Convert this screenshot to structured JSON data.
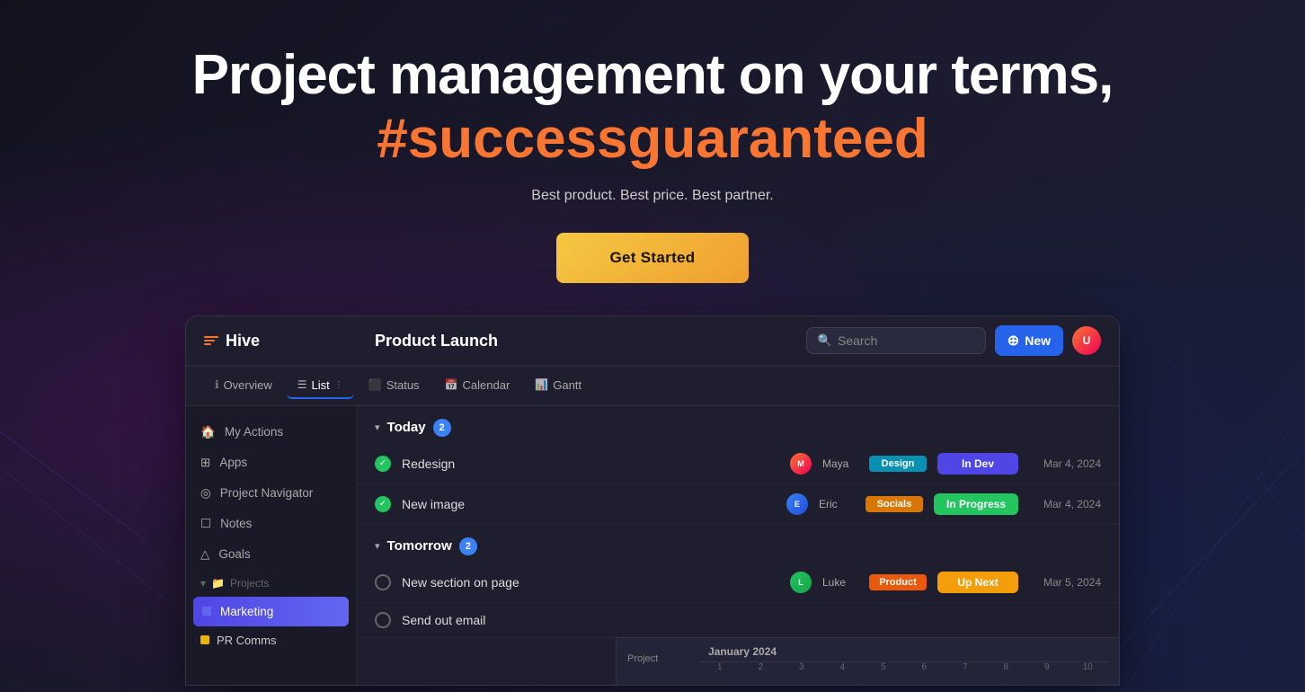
{
  "hero": {
    "title_line1": "Project management on your terms,",
    "title_line2": "#successguaranteed",
    "subtitle": "Best product. Best price. Best partner.",
    "cta": "Get Started"
  },
  "app": {
    "project_title": "Product Launch",
    "search_placeholder": "Search",
    "new_button": "New",
    "tabs": [
      {
        "label": "Overview",
        "icon": "ℹ",
        "active": false
      },
      {
        "label": "List",
        "icon": "☰",
        "active": true
      },
      {
        "label": "Status",
        "icon": "⬛",
        "active": false
      },
      {
        "label": "Calendar",
        "icon": "📅",
        "active": false
      },
      {
        "label": "Gantt",
        "icon": "📊",
        "active": false
      }
    ],
    "sidebar": {
      "logo": "Hive",
      "items": [
        {
          "label": "My Actions",
          "icon": "🏠"
        },
        {
          "label": "Apps",
          "icon": "⊞"
        },
        {
          "label": "Project Navigator",
          "icon": "◎"
        },
        {
          "label": "Notes",
          "icon": "☐"
        },
        {
          "label": "Goals",
          "icon": "△"
        }
      ],
      "section_label": "Projects",
      "projects": [
        {
          "label": "Marketing",
          "color": "#6366f1",
          "active": true
        },
        {
          "label": "PR Comms",
          "color": "#eab308"
        }
      ]
    },
    "sections": [
      {
        "title": "Today",
        "count": 2,
        "tasks": [
          {
            "name": "Redesign",
            "assignee": "Maya",
            "tag": "Design",
            "tag_class": "tag-design",
            "status": "In Dev",
            "status_class": "status-indev",
            "due": "Mar 4, 2024",
            "done": true
          },
          {
            "name": "New image",
            "assignee": "Eric",
            "tag": "Socials",
            "tag_class": "tag-socials",
            "status": "In Progress",
            "status_class": "status-inprogress",
            "due": "Mar 4, 2024",
            "done": true
          }
        ]
      },
      {
        "title": "Tomorrow",
        "count": 2,
        "tasks": [
          {
            "name": "New section on page",
            "assignee": "Luke",
            "tag": "Product",
            "tag_class": "tag-product",
            "status": "Up Next",
            "status_class": "status-upnext",
            "due": "Mar 5, 2024",
            "done": false
          },
          {
            "name": "Send out email",
            "assignee": "",
            "tag": "",
            "tag_class": "",
            "status": "",
            "status_class": "",
            "due": "",
            "done": false
          }
        ]
      }
    ],
    "gantt": {
      "month": "January 2024",
      "days": [
        "1",
        "2",
        "3",
        "4",
        "5",
        "6",
        "7",
        "8",
        "9",
        "10"
      ],
      "project_label": "Project"
    }
  }
}
